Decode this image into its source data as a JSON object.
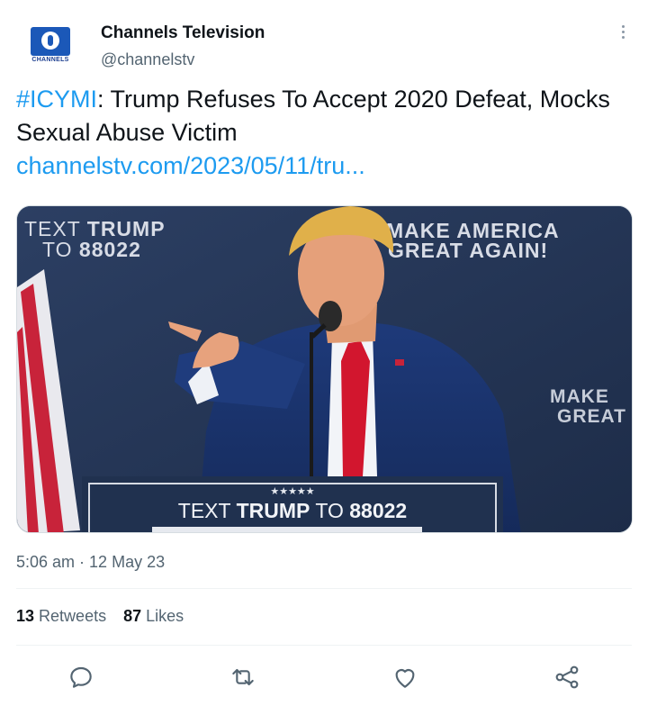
{
  "account": {
    "name": "Channels Television",
    "handle": "@channelstv",
    "avatar_label": "CHANNELS"
  },
  "tweet": {
    "hashtag": "#ICYMI",
    "text": ": Trump Refuses To Accept 2020 Defeat, Mocks Sexual Abuse Victim",
    "link": "channelstv.com/2023/05/11/tru..."
  },
  "media": {
    "sign_top_left": "TEXT TRUMP TO 88022",
    "sign_top_left_line1_a": "TEXT ",
    "sign_top_left_line1_b": "TRUMP",
    "sign_top_left_line2_a": "TO ",
    "sign_top_left_line2_b": "88022",
    "sign_top_right_line1": "MAKE AMERICA",
    "sign_top_right_line2": "GREAT AGAIN!",
    "sign_right_line1": "MAKE",
    "sign_right_line2": "GREAT",
    "podium_stars": "★★★★★",
    "podium_text_a": "TEXT ",
    "podium_text_b": "TRUMP",
    "podium_text_c": " TO ",
    "podium_text_d": "88022"
  },
  "meta": {
    "time": "5:06 am",
    "separator": " · ",
    "date": "12 May 23"
  },
  "stats": {
    "retweets_count": "13",
    "retweets_label": "Retweets",
    "likes_count": "87",
    "likes_label": "Likes"
  },
  "colors": {
    "link": "#1d9bf0",
    "text": "#0f1419",
    "muted": "#536471"
  },
  "icons": [
    "reply-icon",
    "retweet-icon",
    "like-icon",
    "share-icon",
    "more-options-icon"
  ]
}
